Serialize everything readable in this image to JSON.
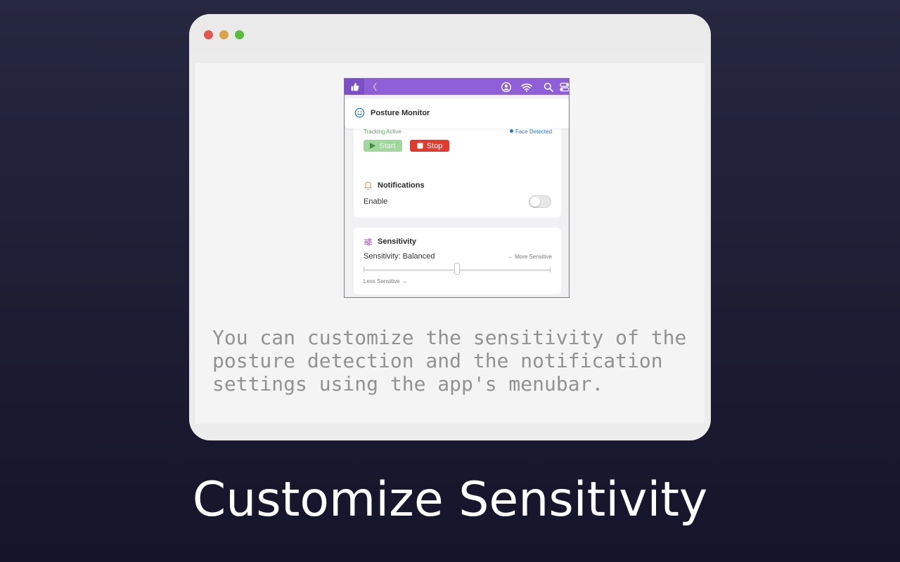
{
  "screenshot": {
    "menubar": {
      "app_icon": "thumbs-up-icon",
      "chevron": "〈",
      "status_icons": [
        "user-circle-icon",
        "wifi-icon",
        "search-icon",
        "control-center-icon"
      ]
    },
    "posture_card": {
      "title": "Posture Monitor",
      "icon": "smiley-face-icon",
      "status_text": "Tracking Active",
      "face_status": "Face Detected",
      "start_label": "Start",
      "stop_label": "Stop"
    },
    "notifications_card": {
      "title": "Notifications",
      "icon": "bell-icon",
      "enable_label": "Enable",
      "enabled": false
    },
    "sensitivity_card": {
      "title": "Sensitivity",
      "icon": "sliders-icon",
      "value_label": "Sensitivity: Balanced",
      "more_label": "← More Sensitive",
      "less_label": "Less Sensitive →",
      "slider_value": 0.5
    }
  },
  "caption": "You can customize the sensitivity of the\nposture detection and the notification\nsettings using the app's menubar.",
  "headline": "Customize Sensitivity",
  "colors": {
    "accent": "#8e5fd7",
    "tracking_green": "#3cb554",
    "face_blue": "#1a7bd8",
    "stop_red": "#e23b2e",
    "start_green": "#9fd79c"
  }
}
